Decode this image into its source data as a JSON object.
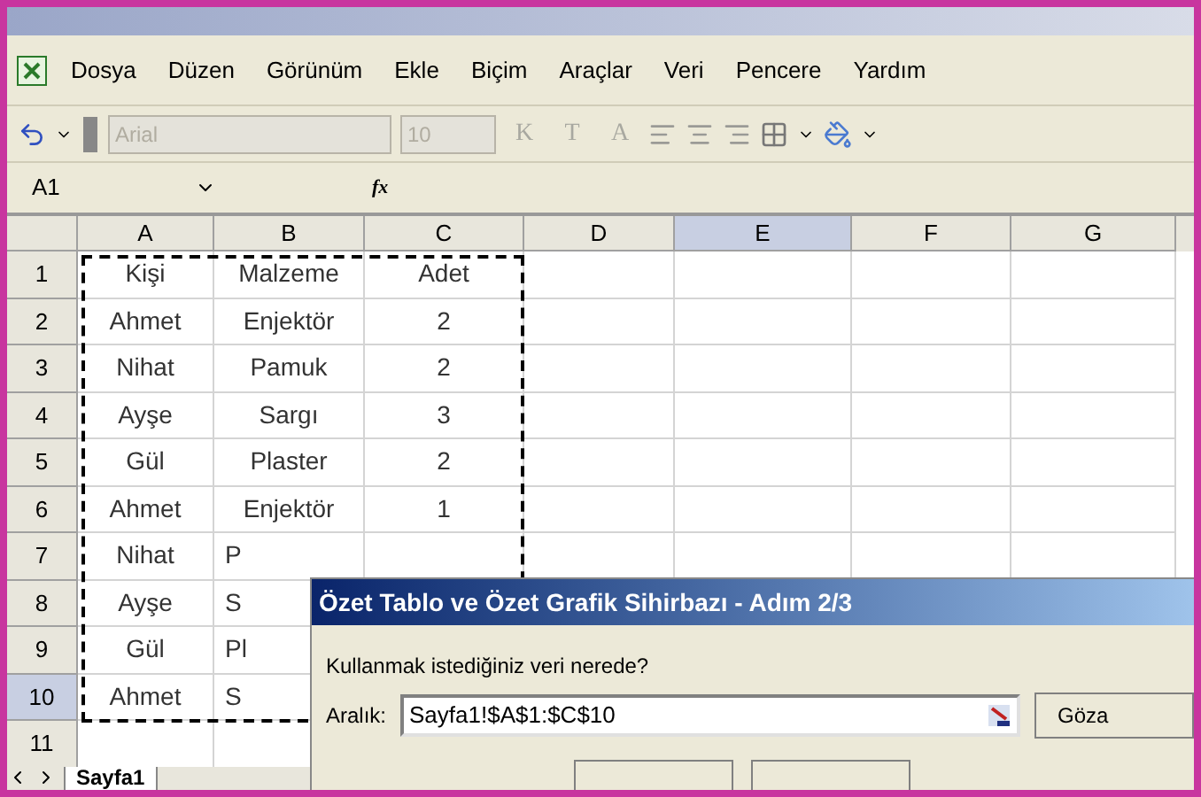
{
  "menu": [
    {
      "label": "Dosya"
    },
    {
      "label": "Düzen"
    },
    {
      "label": "Görünüm"
    },
    {
      "label": "Ekle"
    },
    {
      "label": "Biçim"
    },
    {
      "label": "Araçlar"
    },
    {
      "label": "Veri"
    },
    {
      "label": "Pencere"
    },
    {
      "label": "Yardım"
    }
  ],
  "toolbar": {
    "font": {
      "value": "Arial",
      "disabled": true
    },
    "size": {
      "value": "10",
      "disabled": true
    },
    "format_buttons": [
      "K",
      "T",
      "A"
    ]
  },
  "name_box": "A1",
  "formula_icon": "fx",
  "columns": [
    {
      "label": "A",
      "selected": false
    },
    {
      "label": "B",
      "selected": false
    },
    {
      "label": "C",
      "selected": false
    },
    {
      "label": "D",
      "selected": false
    },
    {
      "label": "E",
      "selected": true
    },
    {
      "label": "F",
      "selected": false
    },
    {
      "label": "G",
      "selected": false
    }
  ],
  "rows": [
    {
      "header": "1",
      "selected": false,
      "covered": false,
      "cells": [
        "Kişi",
        "Malzeme",
        "Adet"
      ]
    },
    {
      "header": "2",
      "selected": false,
      "covered": false,
      "cells": [
        "Ahmet",
        "Enjektör",
        "2"
      ]
    },
    {
      "header": "3",
      "selected": false,
      "covered": false,
      "cells": [
        "Nihat",
        "Pamuk",
        "2"
      ]
    },
    {
      "header": "4",
      "selected": false,
      "covered": false,
      "cells": [
        "Ayşe",
        "Sargı",
        "3"
      ]
    },
    {
      "header": "5",
      "selected": false,
      "covered": false,
      "cells": [
        "Gül",
        "Plaster",
        "2"
      ]
    },
    {
      "header": "6",
      "selected": false,
      "covered": false,
      "cells": [
        "Ahmet",
        "Enjektör",
        "1"
      ]
    },
    {
      "header": "7",
      "selected": false,
      "covered": true,
      "cells": [
        "Nihat",
        "P"
      ]
    },
    {
      "header": "8",
      "selected": false,
      "covered": true,
      "cells": [
        "Ayşe",
        "S"
      ]
    },
    {
      "header": "9",
      "selected": false,
      "covered": true,
      "cells": [
        "Gül",
        "Pl"
      ]
    },
    {
      "header": "10",
      "selected": true,
      "covered": true,
      "cells": [
        "Ahmet",
        "S"
      ]
    },
    {
      "header": "11",
      "selected": false,
      "cells": []
    }
  ],
  "marquee": true,
  "sheet_tabs": [
    {
      "label": "Sayfa1",
      "selected": true
    }
  ],
  "dialog": {
    "title": "Özet Tablo ve Özet Grafik Sihirbazı - Adım 2/3",
    "prompt": "Kullanmak istediğiniz veri nerede?",
    "range_label": "Aralık:",
    "range_value": "Sayfa1!$A$1:$C$10",
    "browse_button": "Göza"
  }
}
